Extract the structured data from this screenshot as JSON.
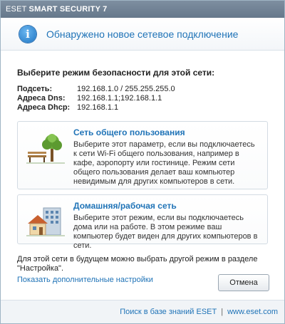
{
  "window": {
    "title_light": "ESET",
    "title_bold": "SMART SECURITY 7"
  },
  "header": {
    "icon": "info-icon",
    "title": "Обнаружено новое сетевое подключение"
  },
  "main": {
    "section_title": "Выберите режим безопасности для этой сети:",
    "network_info": [
      {
        "label": "Подсеть:",
        "value": "192.168.1.0 / 255.255.255.0"
      },
      {
        "label": "Адреса Dns:",
        "value": "192.168.1.1;192.168.1.1"
      },
      {
        "label": "Адреса Dhcp:",
        "value": "192.168.1.1"
      }
    ],
    "options": [
      {
        "icon": "park-bench-tree-icon",
        "title": "Сеть общего пользования",
        "description": "Выберите этот параметр, если вы подключаетесь к сети Wi-Fi общего пользования, например в кафе, аэропорту или гостинице. Режим сети общего пользования делает ваш компьютер невидимым для других компьютеров в сети."
      },
      {
        "icon": "house-office-icon",
        "title": "Домашняя/рабочая сеть",
        "description": "Выберите этот режим, если вы подключаетесь дома или на работе. В этом режиме ваш компьютер будет виден для других компьютеров в сети."
      }
    ],
    "footer_note": "Для этой сети в будущем можно выбрать другой режим в разделе \"Настройка\".",
    "more_settings_link": "Показать дополнительные настройки",
    "cancel_label": "Отмена"
  },
  "bottom": {
    "kb_link": "Поиск в базе знаний ESET",
    "separator": "|",
    "site_link": "www.eset.com"
  },
  "colors": {
    "accent": "#1f73b7",
    "titlebar": "#6e8093"
  }
}
